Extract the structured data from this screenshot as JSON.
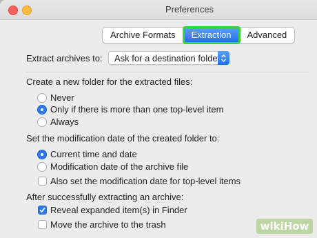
{
  "window": {
    "title": "Preferences"
  },
  "tabs": [
    {
      "label": "Archive Formats",
      "active": false
    },
    {
      "label": "Extraction",
      "active": true
    },
    {
      "label": "Advanced",
      "active": false
    }
  ],
  "extract_to": {
    "label": "Extract archives to:",
    "value": "Ask for a destination folder"
  },
  "new_folder": {
    "heading": "Create a new folder for the extracted files:",
    "options": [
      {
        "label": "Never",
        "selected": false
      },
      {
        "label": "Only if there is more than one top-level item",
        "selected": true
      },
      {
        "label": "Always",
        "selected": false
      }
    ]
  },
  "mod_date": {
    "heading": "Set the modification date of the created folder to:",
    "options": [
      {
        "label": "Current time and date",
        "selected": true
      },
      {
        "label": "Modification date of the archive file",
        "selected": false
      }
    ],
    "also_label": "Also set the modification date for top-level items",
    "also_checked": false
  },
  "after": {
    "heading": "After successfully extracting an archive:",
    "reveal_label": "Reveal expanded item(s) in Finder",
    "reveal_checked": true,
    "trash_label": "Move the archive to the trash",
    "trash_checked": false
  },
  "watermark": "wikiHow",
  "colors": {
    "accent": "#2d79ea",
    "highlight": "#36d33a"
  }
}
